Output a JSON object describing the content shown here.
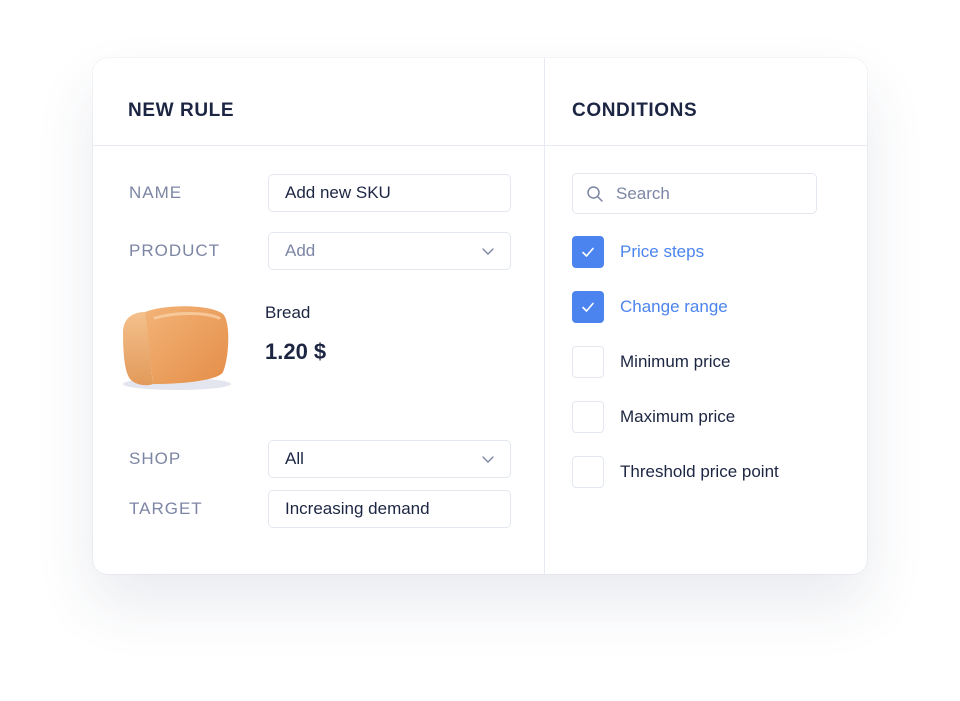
{
  "rule_panel": {
    "title": "NEW RULE",
    "fields": {
      "name": {
        "label": "NAME",
        "value": "Add new SKU"
      },
      "product": {
        "label": "PRODUCT",
        "placeholder": "Add",
        "icon": "chevron-down-icon"
      },
      "shop": {
        "label": "SHOP",
        "value": "All",
        "icon": "chevron-down-icon"
      },
      "target": {
        "label": "TARGET",
        "value": "Increasing demand"
      }
    },
    "product_card": {
      "image": "bread-loaf-image",
      "name": "Bread",
      "price": "1.20 $"
    }
  },
  "conditions_panel": {
    "title": "CONDITIONS",
    "search": {
      "placeholder": "Search",
      "icon": "search-icon"
    },
    "items": [
      {
        "label": "Price steps",
        "checked": true
      },
      {
        "label": "Change range",
        "checked": true
      },
      {
        "label": "Minimum price",
        "checked": false
      },
      {
        "label": "Maximum price",
        "checked": false
      },
      {
        "label": "Threshold price point",
        "checked": false
      }
    ]
  },
  "colors": {
    "accent": "#4b84ee",
    "text_dark": "#1c2643",
    "text_muted": "#7c86a4",
    "border": "#e3e7f0"
  }
}
